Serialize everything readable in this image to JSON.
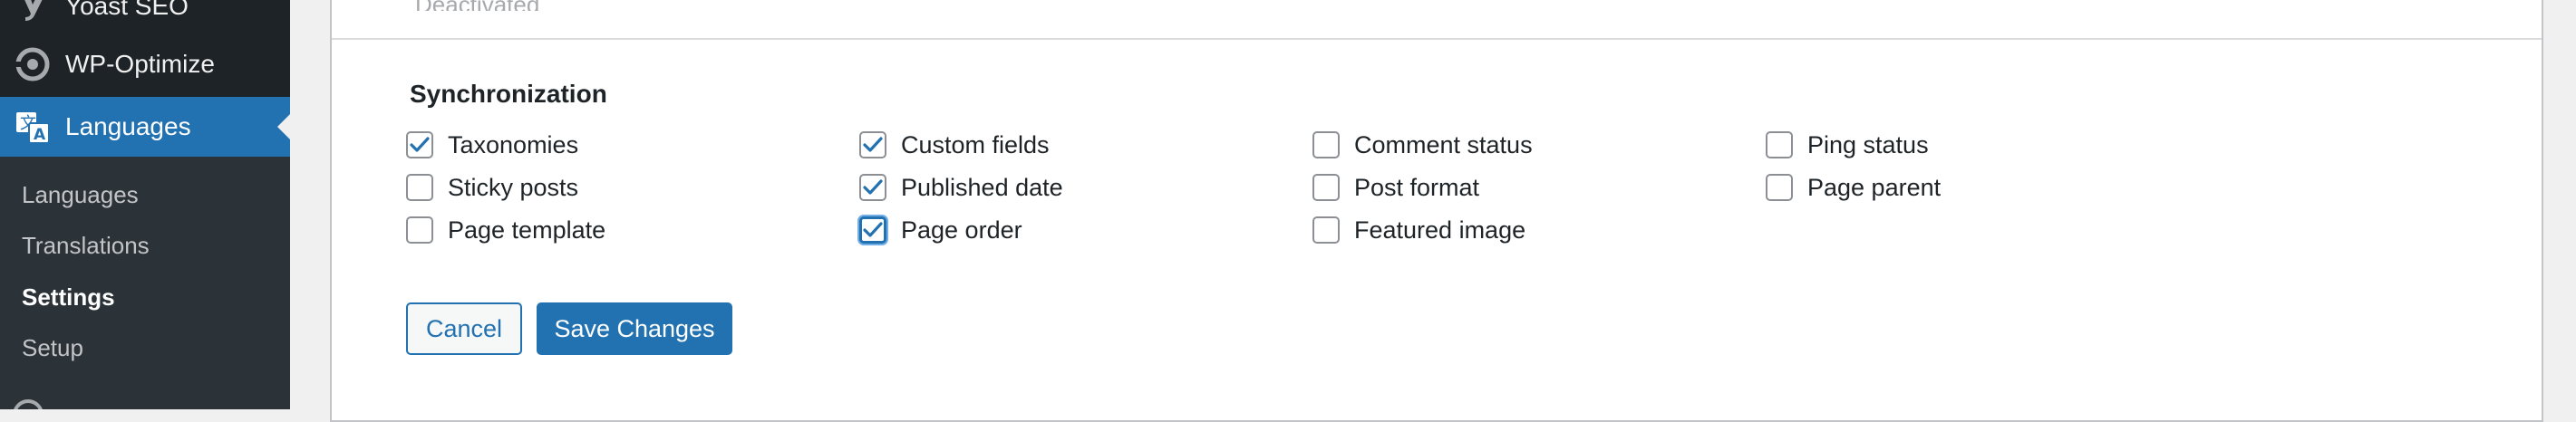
{
  "sidebar": {
    "menu": [
      {
        "label": "Yoast SEO",
        "icon": "yoast-icon"
      },
      {
        "label": "WP-Optimize",
        "icon": "wp-optimize-icon"
      },
      {
        "label": "Languages",
        "icon": "translation-icon",
        "active": true
      }
    ],
    "submenu": [
      {
        "label": "Languages"
      },
      {
        "label": "Translations"
      },
      {
        "label": "Settings",
        "current": true
      },
      {
        "label": "Setup"
      }
    ]
  },
  "panel": {
    "top_row_text": "Deactivated",
    "section_title": "Synchronization",
    "options": [
      {
        "label": "Taxonomies",
        "checked": true
      },
      {
        "label": "Custom fields",
        "checked": true
      },
      {
        "label": "Comment status",
        "checked": false
      },
      {
        "label": "Ping status",
        "checked": false
      },
      {
        "label": "Sticky posts",
        "checked": false
      },
      {
        "label": "Published date",
        "checked": true
      },
      {
        "label": "Post format",
        "checked": false
      },
      {
        "label": "Page parent",
        "checked": false
      },
      {
        "label": "Page template",
        "checked": false
      },
      {
        "label": "Page order",
        "checked": true,
        "focused": true
      },
      {
        "label": "Featured image",
        "checked": false
      }
    ],
    "cancel_label": "Cancel",
    "save_label": "Save Changes"
  },
  "colors": {
    "sidebar_bg": "#1d2327",
    "submenu_bg": "#2c3338",
    "accent": "#2271b1",
    "panel_bg": "#ffffff"
  }
}
